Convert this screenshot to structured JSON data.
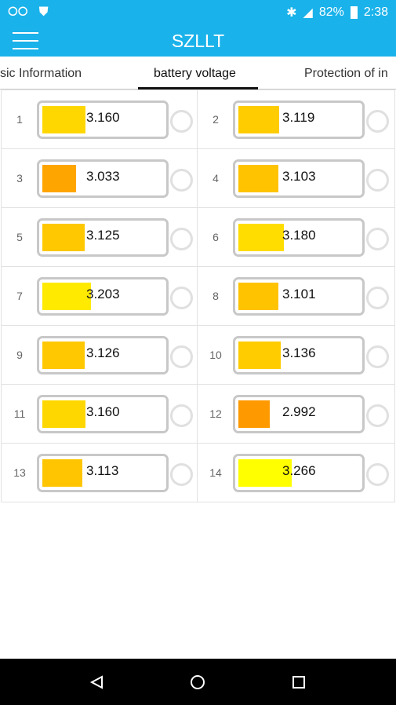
{
  "status": {
    "battery": "82%",
    "time": "2:38"
  },
  "app": {
    "title": "SZLLT"
  },
  "tabs": [
    {
      "label": "sic Information"
    },
    {
      "label": "battery voltage",
      "active": true
    },
    {
      "label": "Protection of in"
    }
  ],
  "cells": [
    {
      "index": "1",
      "voltage": "3.160",
      "level": 0.35,
      "color": "#FFD700"
    },
    {
      "index": "2",
      "voltage": "3.119",
      "level": 0.33,
      "color": "#FFCC00"
    },
    {
      "index": "3",
      "voltage": "3.033",
      "level": 0.27,
      "color": "#FFA500"
    },
    {
      "index": "4",
      "voltage": "3.103",
      "level": 0.32,
      "color": "#FFC300"
    },
    {
      "index": "5",
      "voltage": "3.125",
      "level": 0.34,
      "color": "#FFC800"
    },
    {
      "index": "6",
      "voltage": "3.180",
      "level": 0.37,
      "color": "#FFDD00"
    },
    {
      "index": "7",
      "voltage": "3.203",
      "level": 0.39,
      "color": "#FFEA00"
    },
    {
      "index": "8",
      "voltage": "3.101",
      "level": 0.32,
      "color": "#FFC300"
    },
    {
      "index": "9",
      "voltage": "3.126",
      "level": 0.34,
      "color": "#FFC800"
    },
    {
      "index": "10",
      "voltage": "3.136",
      "level": 0.34,
      "color": "#FFCC00"
    },
    {
      "index": "11",
      "voltage": "3.160",
      "level": 0.35,
      "color": "#FFD700"
    },
    {
      "index": "12",
      "voltage": "2.992",
      "level": 0.25,
      "color": "#FF9900"
    },
    {
      "index": "13",
      "voltage": "3.113",
      "level": 0.32,
      "color": "#FFC500"
    },
    {
      "index": "14",
      "voltage": "3.266",
      "level": 0.43,
      "color": "#FFFF00"
    }
  ]
}
